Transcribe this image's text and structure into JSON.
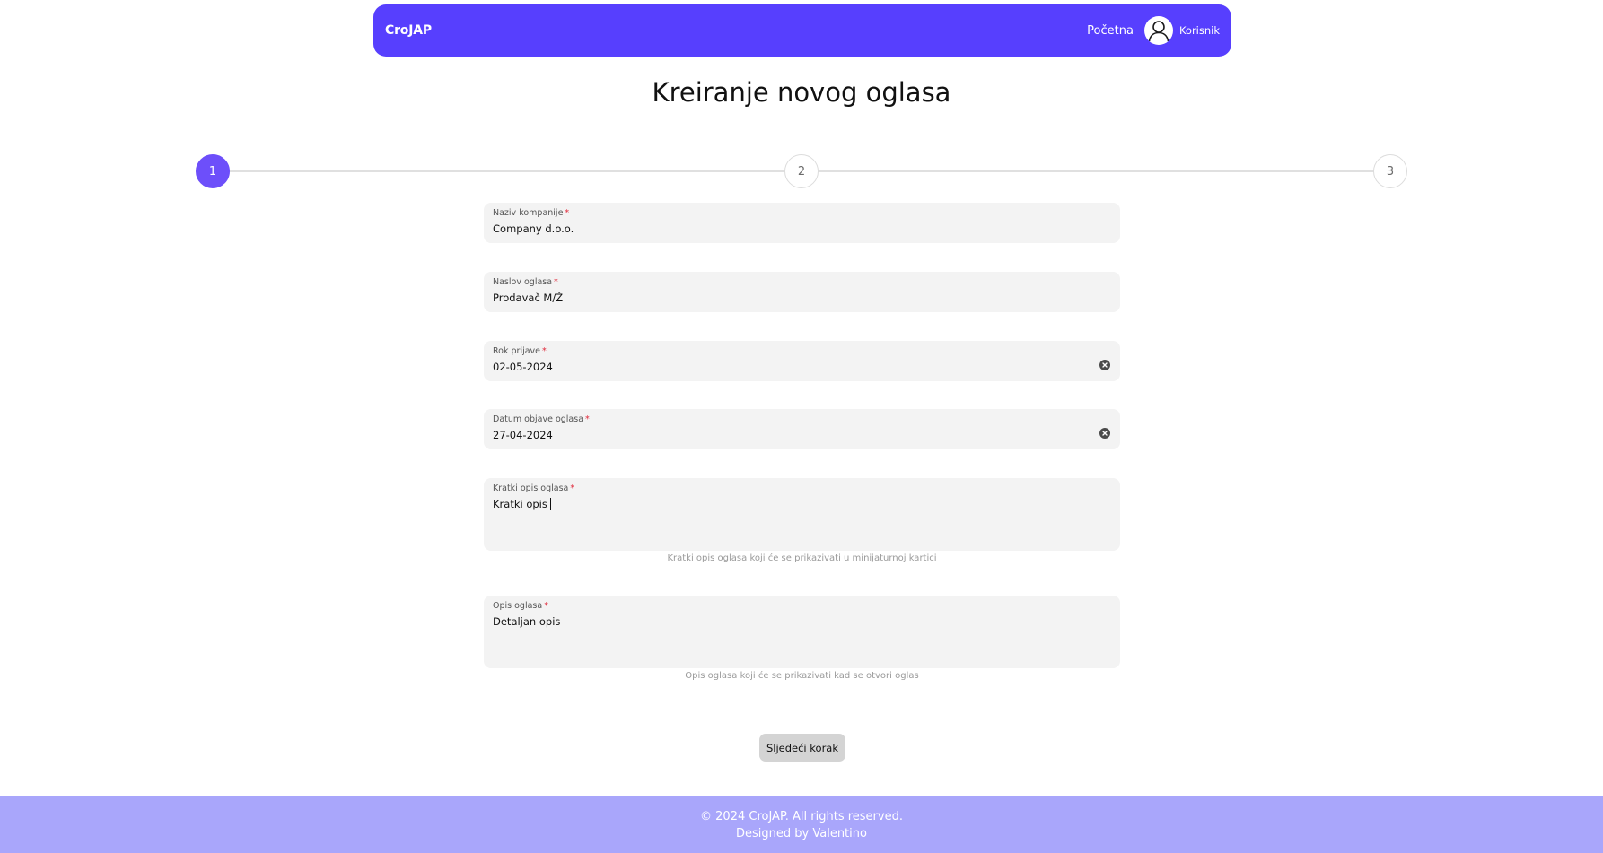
{
  "navbar": {
    "brand": "CroJAP",
    "home_link": "Početna",
    "user_name": "Korisnik",
    "avatar_icon": "user-icon",
    "background": "#573ffe"
  },
  "page_title": "Kreiranje novog oglasa",
  "stepper": {
    "steps": [
      "1",
      "2",
      "3"
    ],
    "active_step": 1,
    "active_color": "#6d4ffa"
  },
  "form": {
    "company": {
      "label": "Naziv kompanije",
      "required_mark": "*",
      "value": "Company d.o.o."
    },
    "title": {
      "label": "Naslov oglasa",
      "required_mark": "*",
      "value": "Prodavač M/Ž"
    },
    "deadline": {
      "label": "Rok prijave",
      "required_mark": "*",
      "value": "02-05-2024",
      "clear_icon": "clear-circle-icon"
    },
    "publish_date": {
      "label": "Datum objave oglasa",
      "required_mark": "*",
      "value": "27-04-2024",
      "clear_icon": "clear-circle-icon"
    },
    "short_desc": {
      "label": "Kratki opis oglasa",
      "required_mark": "*",
      "value": "Kratki opis",
      "helper": "Kratki opis oglasa koji će se prikazivati u minijaturnoj kartici"
    },
    "description": {
      "label": "Opis oglasa",
      "required_mark": "*",
      "value": "Detaljan opis",
      "helper": "Opis oglasa koji će se prikazivati kad se otvori oglas"
    }
  },
  "next_button": "Sljedeći korak",
  "footer": {
    "copyright": "© 2024 CroJAP. All rights reserved.",
    "designer": "Designed by Valentino",
    "background": "#a9a6fb"
  }
}
